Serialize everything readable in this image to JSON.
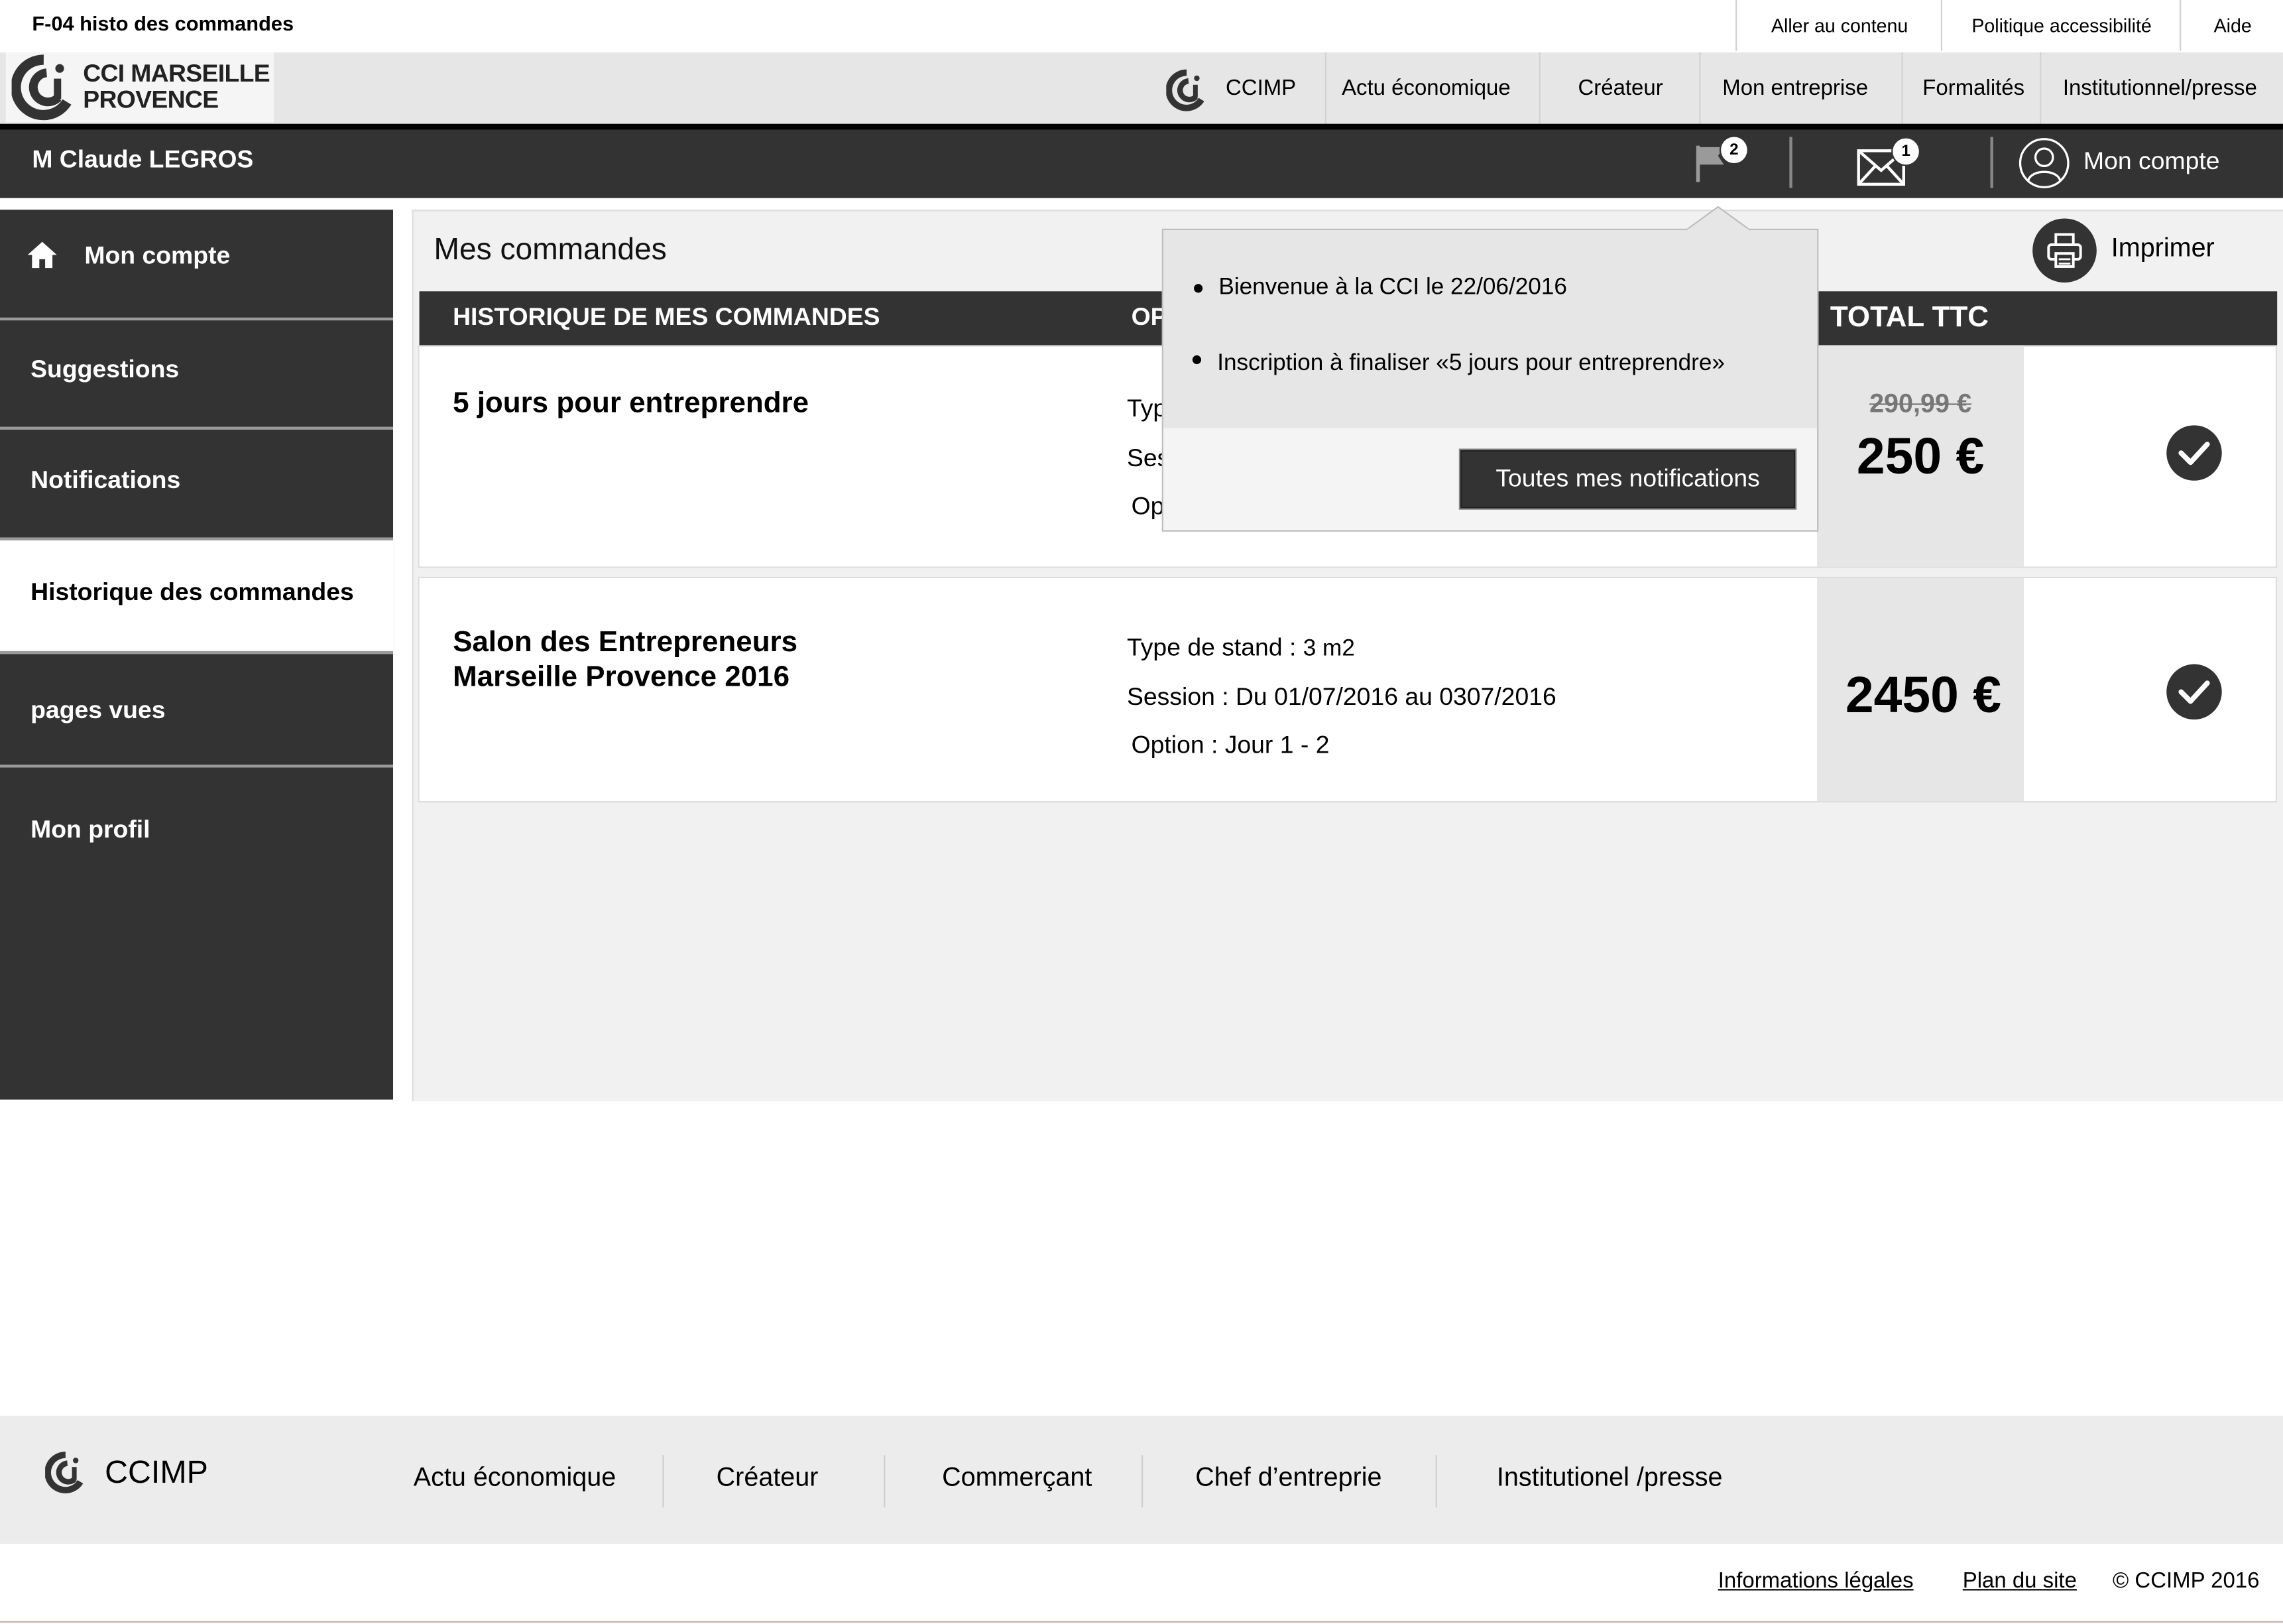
{
  "page_label": "F-04 histo des commandes",
  "utility_links": [
    "Aller au contenu",
    "Politique accessibilité",
    "Aide"
  ],
  "logo": {
    "line1": "CCI MARSEILLE",
    "line2": "PROVENCE",
    "icon": "cci-logo-icon"
  },
  "nav": {
    "ccimp": "CCIMP",
    "items": [
      "Actu économique",
      "Créateur",
      "Mon entreprise",
      "Formalités",
      "Institutionnel/presse"
    ]
  },
  "userbar": {
    "username": "M Claude LEGROS",
    "flag_count": "2",
    "mail_count": "1",
    "account_label": "Mon compte",
    "icons": [
      "flag-icon",
      "envelope-icon",
      "user-avatar-icon"
    ]
  },
  "sidebar": {
    "items": [
      "Mon compte",
      "Suggestions",
      "Notifications",
      "Historique des commandes",
      "pages vues",
      "Mon profil"
    ],
    "active": "Historique des commandes"
  },
  "main": {
    "title": "Mes commandes",
    "print_label": "Imprimer",
    "table_headers": {
      "history": "HISTORIQUE DE MES COMMANDES",
      "options": "OP",
      "total": "TOTAL TTC"
    },
    "orders": [
      {
        "title_lines": [
          "5 jours pour entreprendre"
        ],
        "meta": [
          "Typ",
          "Ses",
          "Op"
        ],
        "old_price": "290,99 €",
        "price": "250 €",
        "status_icon": "checkmark-icon"
      },
      {
        "title_lines": [
          "Salon des Entrepreneurs",
          "Marseille Provence 2016"
        ],
        "meta_type_label": "Type de stand :",
        "meta_type_value": "3 m2",
        "meta_session": "Session : Du 01/07/2016 au 0307/2016",
        "meta_option": "Option : Jour 1 - 2",
        "price": "2450 €",
        "status_icon": "checkmark-icon"
      }
    ]
  },
  "notifications_popover": {
    "items": [
      "Bienvenue à la CCI le 22/06/2016",
      "Inscription à finaliser «5 jours pour entreprendre»"
    ],
    "button": "Toutes mes notifications"
  },
  "footer": {
    "brand": "CCIMP",
    "items": [
      "Actu économique",
      "Créateur",
      "Commerçant",
      "Chef d’entreprie",
      "Institutionel /presse"
    ],
    "legal": [
      "Informations légales",
      "Plan du site"
    ],
    "copyright": "© CCIMP 2016"
  },
  "colors": {
    "dark": "#333333",
    "nav_bg": "#e6e6e6",
    "main_bg": "#f1f1f1"
  }
}
